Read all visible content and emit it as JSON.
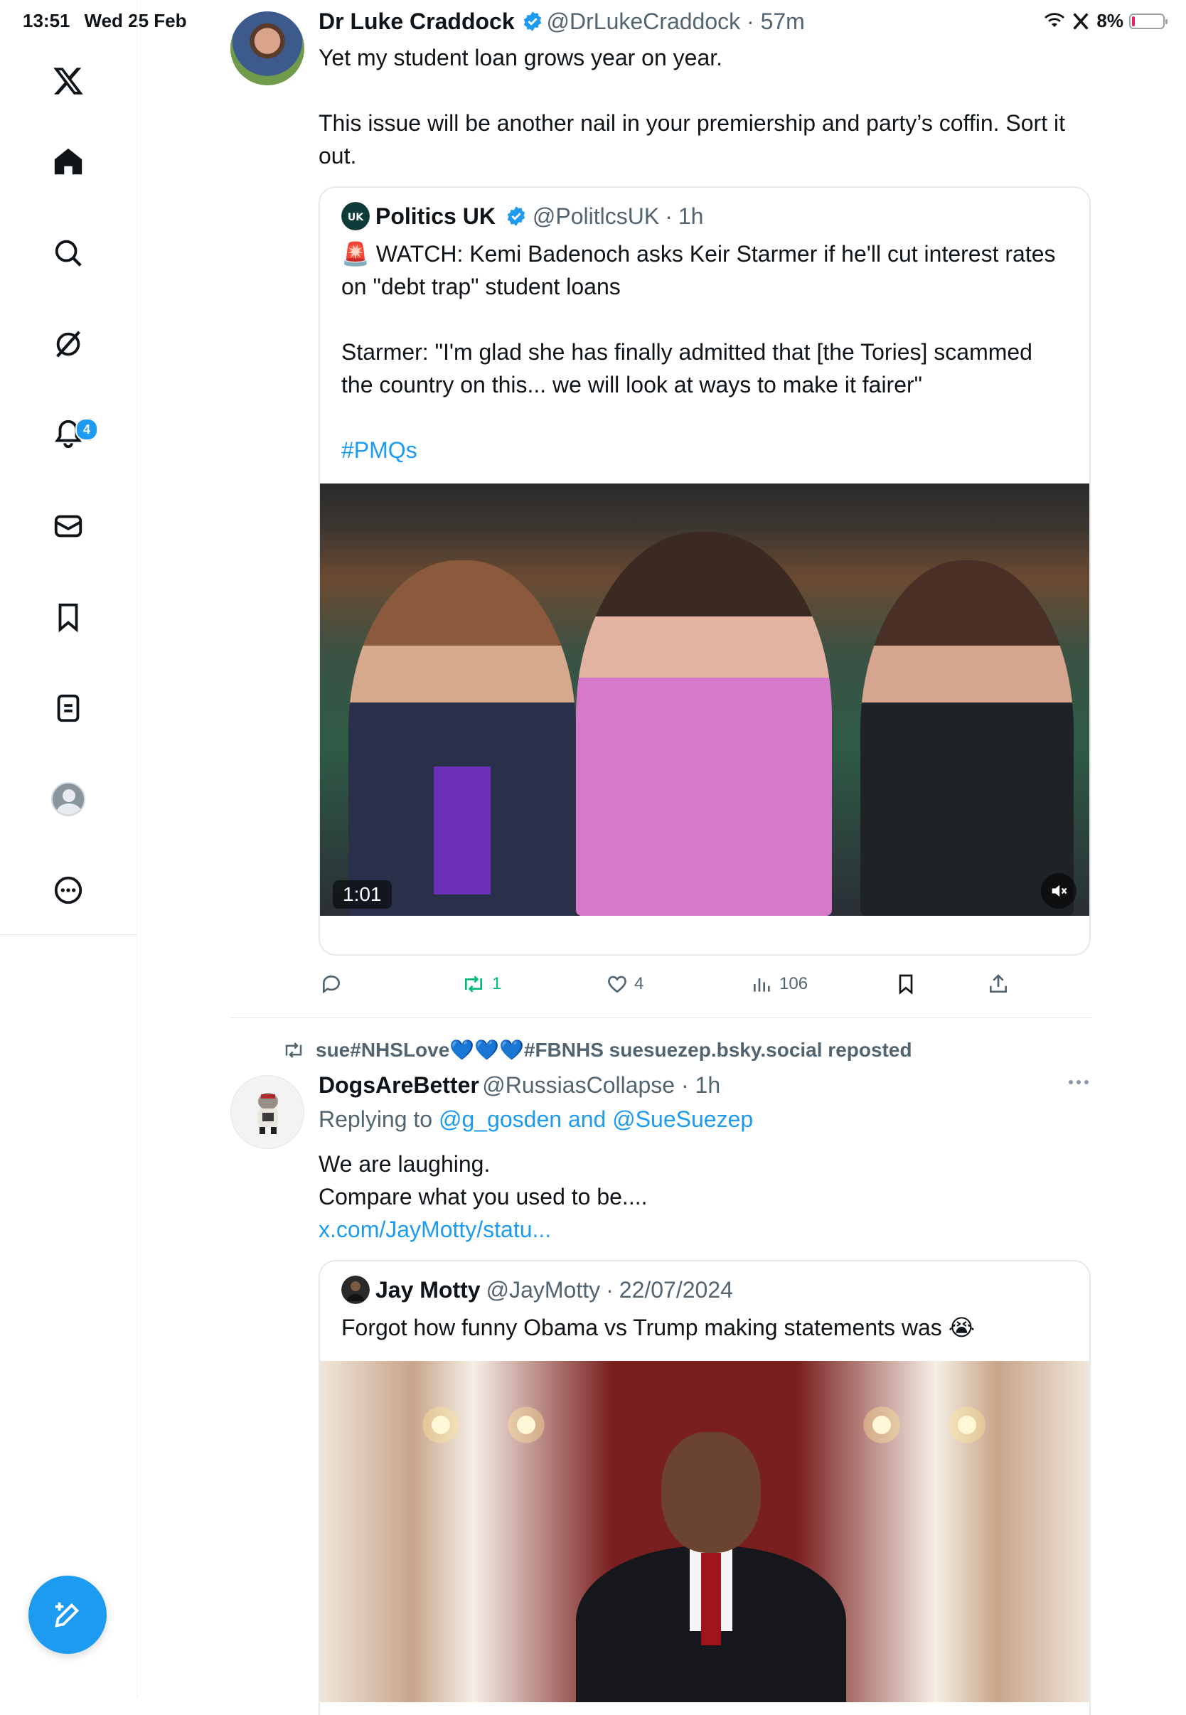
{
  "status_bar": {
    "time": "13:51",
    "date": "Wed 25 Feb",
    "battery": "8%"
  },
  "sidebar": {
    "notification_count": "4",
    "items": [
      "x-logo-icon",
      "home-icon",
      "search-icon",
      "grok-icon",
      "notifications-icon",
      "messages-icon",
      "bookmarks-icon",
      "lists-icon",
      "profile-icon",
      "more-icon"
    ]
  },
  "tweet1": {
    "name": "Dr Luke Craddock",
    "handle": "@DrLukeCraddock",
    "time": "57m",
    "text": "Yet my student loan grows year on year.\n\nThis issue will be another nail in your premiership and party’s coffin. Sort it out.",
    "quote": {
      "name": "Politics UK",
      "handle": "@PolitlcsUK",
      "time": "1h",
      "avatar_text": "UK",
      "emoji": "🚨",
      "text": "WATCH: Kemi Badenoch asks Keir Starmer if he'll cut interest rates on \"debt trap\" student loans\n\nStarmer: \"I'm glad she has finally admitted that [the Tories] scammed the country on this... we will look at ways to make it fairer\"",
      "hashtag": "#PMQs",
      "video_duration": "1:01"
    },
    "actions": {
      "replies": "",
      "reposts": "1",
      "likes": "4",
      "views": "106"
    }
  },
  "tweet2": {
    "repost_by": "sue#NHSLove💙💙💙#FBNHS suesuezep.bsky.social reposted",
    "name": "DogsAreBetter",
    "handle": "@RussiasCollapse",
    "time": "1h",
    "replying_prefix": "Replying to ",
    "replying_to": "@g_gosden and @SueSuezep",
    "text": "We are laughing.\nCompare what you used to be....",
    "link": "x.com/JayMotty/statu...",
    "quote": {
      "name": "Jay Motty",
      "handle": "@JayMotty",
      "time": "22/07/2024",
      "text": "Forgot how funny Obama vs Trump making statements was 😭"
    }
  },
  "colors": {
    "accent": "#1d9bf0",
    "repost_green": "#00ba7c",
    "muted": "#536471"
  }
}
